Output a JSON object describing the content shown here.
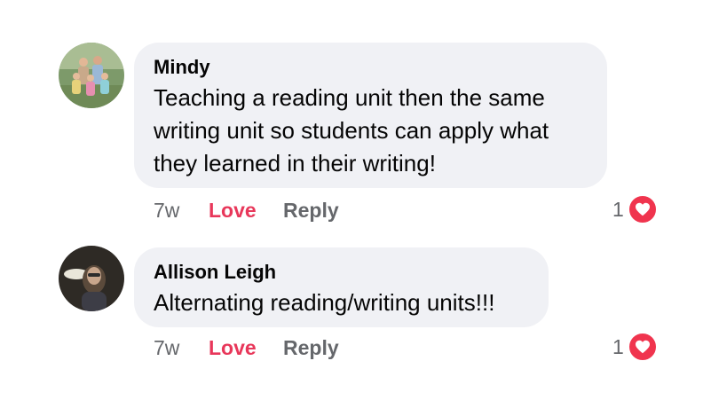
{
  "comments": [
    {
      "author": "Mindy",
      "text": "Teaching a reading unit then the same writing unit so students can apply what they learned in their writing!",
      "time": "7w",
      "love_label": "Love",
      "reply_label": "Reply",
      "reaction_count": "1",
      "reaction_icon": "heart-icon"
    },
    {
      "author": "Allison Leigh",
      "text": "Alternating reading/writing units!!!",
      "time": "7w",
      "love_label": "Love",
      "reply_label": "Reply",
      "reaction_count": "1",
      "reaction_icon": "heart-icon"
    }
  ],
  "colors": {
    "bubble": "#f0f1f5",
    "love": "#e8375a",
    "muted": "#65676b",
    "heart_badge": "#f0344e"
  }
}
